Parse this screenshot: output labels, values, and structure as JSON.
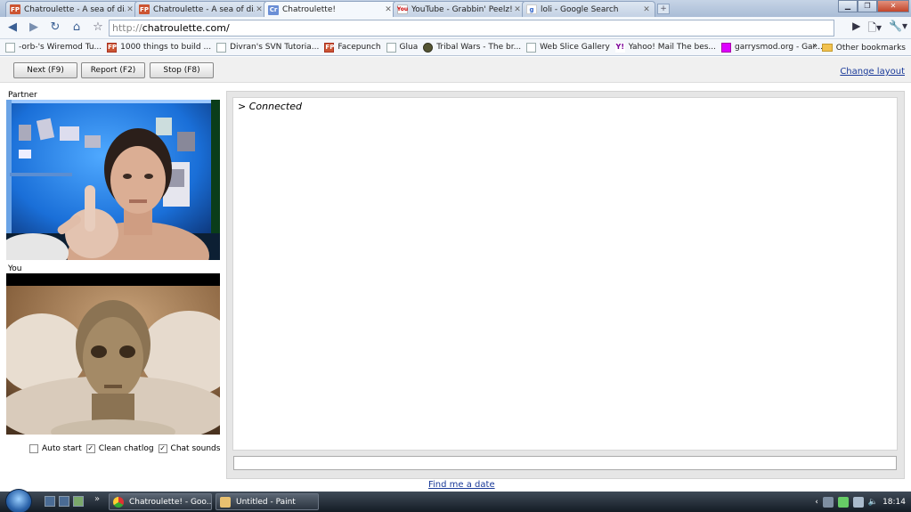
{
  "browser": {
    "tabs": [
      {
        "title": "Chatroulette - A sea of di...",
        "favicon": "FP"
      },
      {
        "title": "Chatroulette - A sea of di...",
        "favicon": "FP"
      },
      {
        "title": "Chatroulette!",
        "favicon": "Cr",
        "active": true
      },
      {
        "title": "YouTube - Grabbin' Peelz!",
        "favicon": "You"
      },
      {
        "title": "loli - Google Search",
        "favicon": "g"
      }
    ],
    "new_tab": "+",
    "url_protocol": "http://",
    "url_host": "chatroulette.com/",
    "bookmarks": [
      {
        "label": "-orb-'s Wiremod Tu...",
        "icon": "page-icon"
      },
      {
        "label": "1000 things to build ...",
        "icon": "facepunch-icon"
      },
      {
        "label": "Divran's SVN Tutoria...",
        "icon": "page-icon"
      },
      {
        "label": "Facepunch",
        "icon": "facepunch-icon"
      },
      {
        "label": "Glua",
        "icon": "page-icon"
      },
      {
        "label": "Tribal Wars - The br...",
        "icon": "tribalwars-icon"
      },
      {
        "label": "Web Slice Gallery",
        "icon": "page-icon"
      },
      {
        "label": "Yahoo! Mail The bes...",
        "icon": "yahoo-icon"
      },
      {
        "label": "garrysmod.org - Gar...",
        "icon": "gmod-icon"
      }
    ],
    "bookmarks_overflow": "»",
    "other_bookmarks": "Other bookmarks"
  },
  "page": {
    "buttons": {
      "next": "Next (F9)",
      "report": "Report (F2)",
      "stop": "Stop (F8)"
    },
    "change_layout": "Change layout",
    "partner_label": "Partner",
    "you_label": "You",
    "chat_log": "> Connected",
    "options": [
      {
        "label": "Auto start",
        "checked": false
      },
      {
        "label": "Clean chatlog",
        "checked": true
      },
      {
        "label": "Chat sounds",
        "checked": true
      }
    ],
    "find_date": "Find me a date"
  },
  "taskbar": {
    "items": [
      {
        "label": "Chatroulette! - Goo..."
      },
      {
        "label": "Untitled - Paint"
      }
    ],
    "clock": "18:14"
  }
}
